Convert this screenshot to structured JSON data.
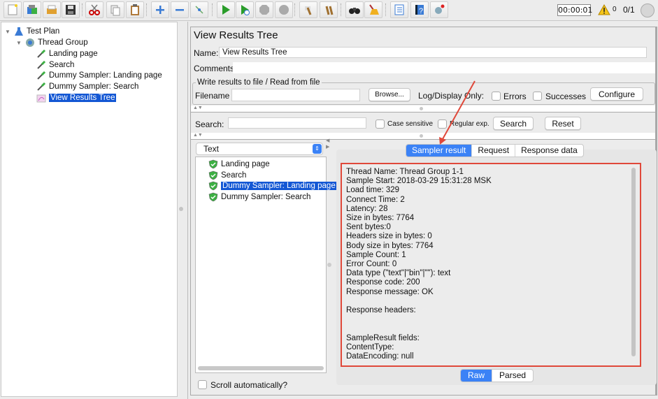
{
  "toolbar": {
    "buttons": [
      {
        "name": "new-icon"
      },
      {
        "name": "templates-icon"
      },
      {
        "name": "open-icon"
      },
      {
        "name": "save-icon"
      },
      {
        "name": "cut-icon"
      },
      {
        "name": "copy-icon"
      },
      {
        "name": "paste-icon"
      },
      {
        "name": "expand-icon"
      },
      {
        "name": "collapse-icon"
      },
      {
        "name": "toggle-icon"
      },
      {
        "name": "start-icon"
      },
      {
        "name": "start-no-timers-icon"
      },
      {
        "name": "stop-icon"
      },
      {
        "name": "shutdown-icon"
      },
      {
        "name": "clear-icon"
      },
      {
        "name": "clear-all-icon"
      },
      {
        "name": "search-icon"
      },
      {
        "name": "reset-search-icon"
      },
      {
        "name": "function-helper-icon"
      },
      {
        "name": "help-icon"
      },
      {
        "name": "remote-icon"
      }
    ],
    "timer": "00:00:01",
    "warning_count": "0",
    "threads": "0/1"
  },
  "tree": {
    "items": [
      {
        "label": "Test Plan",
        "icon": "test-plan-icon"
      },
      {
        "label": "Thread Group",
        "icon": "thread-group-icon"
      },
      {
        "label": "Landing page",
        "icon": "sampler-icon"
      },
      {
        "label": "Search",
        "icon": "sampler-icon"
      },
      {
        "label": "Dummy Sampler: Landing page",
        "icon": "sampler-icon"
      },
      {
        "label": "Dummy Sampler: Search",
        "icon": "sampler-icon"
      },
      {
        "label": "View Results Tree",
        "icon": "listener-icon",
        "selected": true
      }
    ]
  },
  "panel": {
    "title": "View Results Tree",
    "name_label": "Name:",
    "name_value": "View Results Tree",
    "comments_label": "Comments:",
    "comments_value": "",
    "file_group_label": "Write results to file / Read from file",
    "filename_label": "Filename",
    "filename_value": "",
    "browse_label": "Browse...",
    "log_display_label": "Log/Display Only:",
    "errors_label": "Errors",
    "successes_label": "Successes",
    "configure_label": "Configure",
    "search_label": "Search:",
    "search_value": "",
    "case_sensitive_label": "Case sensitive",
    "regex_label": "Regular exp.",
    "search_button": "Search",
    "reset_button": "Reset",
    "renderer": "Text",
    "results": [
      {
        "label": "Landing page",
        "status": "success"
      },
      {
        "label": "Search",
        "status": "success"
      },
      {
        "label": "Dummy Sampler: Landing page",
        "status": "success",
        "selected": true
      },
      {
        "label": "Dummy Sampler: Search",
        "status": "success"
      }
    ],
    "tabs": [
      "Sampler result",
      "Request",
      "Response data"
    ],
    "active_tab": "Sampler result",
    "sampler_result": "Thread Name: Thread Group 1-1\nSample Start: 2018-03-29 15:31:28 MSK\nLoad time: 329\nConnect Time: 2\nLatency: 28\nSize in bytes: 7764\nSent bytes:0\nHeaders size in bytes: 0\nBody size in bytes: 7764\nSample Count: 1\nError Count: 0\nData type (\"text\"|\"bin\"|\"\"): text\nResponse code: 200\nResponse message: OK\n\nResponse headers:\n\n\nSampleResult fields:\nContentType:\nDataEncoding: null",
    "view_modes": [
      "Raw",
      "Parsed"
    ],
    "active_view_mode": "Raw",
    "scroll_auto_label": "Scroll automatically?"
  },
  "colors": {
    "accent": "#3b82f6",
    "selection": "#1357d4",
    "highlight": "#e0483a"
  }
}
